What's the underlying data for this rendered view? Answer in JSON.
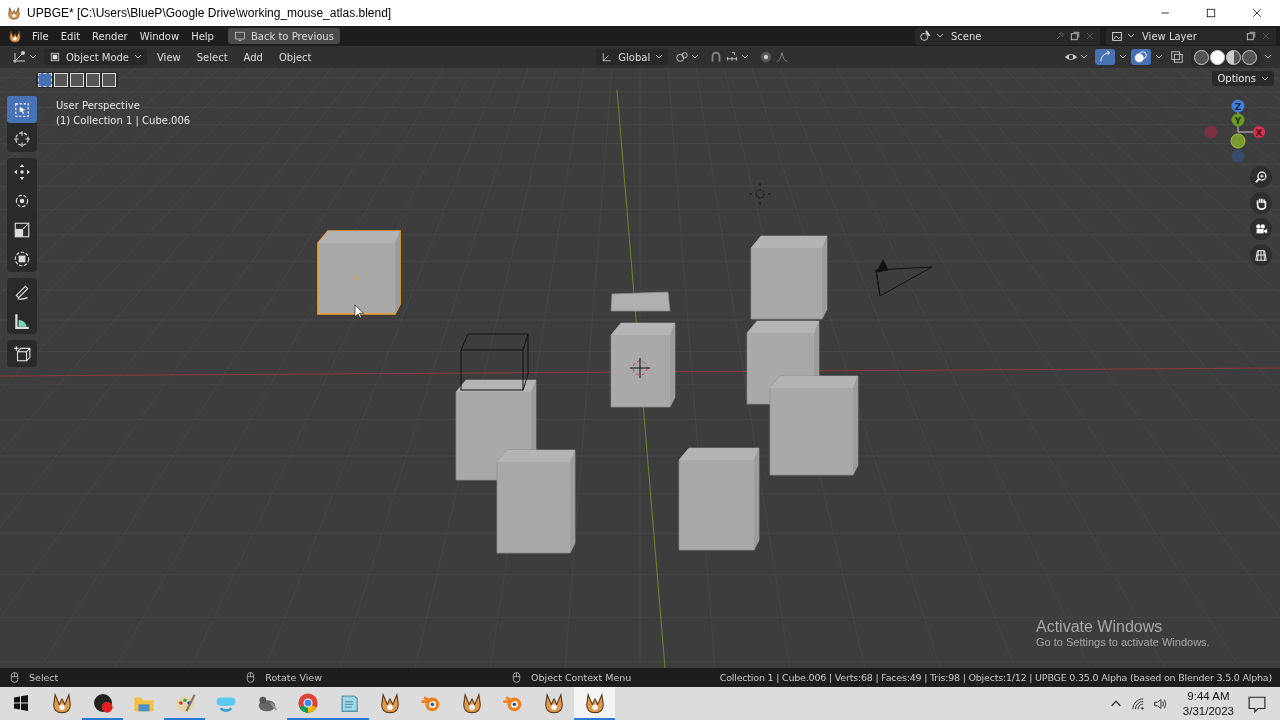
{
  "window": {
    "title": "UPBGE* [C:\\Users\\BlueP\\Google Drive\\working_mouse_atlas.blend]"
  },
  "menu": [
    "File",
    "Edit",
    "Render",
    "Window",
    "Help"
  ],
  "back_button": "Back to Previous",
  "scene": {
    "name": "Scene"
  },
  "view_layer": {
    "name": "View Layer"
  },
  "header": {
    "mode": "Object Mode",
    "menus": [
      "View",
      "Select",
      "Add",
      "Object"
    ],
    "orientation": "Global"
  },
  "select_modes": [
    {
      "selected": true
    },
    {
      "selected": false
    },
    {
      "selected": false
    },
    {
      "selected": false
    },
    {
      "selected": false
    }
  ],
  "shading_modes": [
    {
      "selected": false
    },
    {
      "selected": true
    },
    {
      "selected": false
    },
    {
      "selected": false
    }
  ],
  "options_button": "Options",
  "viewport": {
    "view_name": "User Perspective",
    "context": "(1) Collection 1 | Cube.006"
  },
  "tools": [
    {
      "kind": "select",
      "selected": true
    },
    {
      "kind": "cursor",
      "selected": false
    },
    {
      "kind": "move",
      "selected": false
    },
    {
      "kind": "rotate",
      "selected": false
    },
    {
      "kind": "scale",
      "selected": false
    },
    {
      "kind": "transform",
      "selected": false
    },
    {
      "kind": "annotate",
      "selected": false
    },
    {
      "kind": "measure",
      "selected": false
    },
    {
      "kind": "add-cube",
      "selected": false
    }
  ],
  "gizmo": {
    "z": "Z",
    "y": "Y",
    "x": "X"
  },
  "objects": [
    {
      "kind": "cube",
      "selected": true
    },
    {
      "kind": "cube",
      "selected": false
    },
    {
      "kind": "cube",
      "selected": false
    },
    {
      "kind": "cube",
      "selected": false
    },
    {
      "kind": "cube",
      "selected": false
    },
    {
      "kind": "cube",
      "selected": false
    },
    {
      "kind": "cube",
      "selected": false
    },
    {
      "kind": "cube",
      "selected": false
    },
    {
      "kind": "plane",
      "selected": false
    },
    {
      "kind": "wire-cube",
      "selected": false
    },
    {
      "kind": "light",
      "selected": false
    },
    {
      "kind": "camera",
      "selected": false
    }
  ],
  "activation": {
    "title": "Activate Windows",
    "subtitle": "Go to Settings to activate Windows."
  },
  "status_bar": {
    "hints": [
      "Select",
      "Rotate View",
      "Object Context Menu"
    ],
    "stats": "Collection 1 | Cube.006 | Verts:68 | Faces:49 | Tris:98 | Objects:1/12 | UPBGE 0.35.0 Alpha (based on Blender 3.5.0 Alpha)"
  },
  "taskbar": {
    "apps": [
      {
        "kind": "upbge",
        "running": false,
        "selected": false
      },
      {
        "kind": "recorder",
        "running": true,
        "selected": false
      },
      {
        "kind": "folder",
        "running": false,
        "selected": false
      },
      {
        "kind": "paint",
        "running": true,
        "selected": false
      },
      {
        "kind": "headset",
        "running": false,
        "selected": false
      },
      {
        "kind": "gimp",
        "running": false,
        "selected": false
      },
      {
        "kind": "browser",
        "running": true,
        "selected": false
      },
      {
        "kind": "notepad",
        "running": true,
        "selected": false
      },
      {
        "kind": "upbge",
        "running": false,
        "selected": false
      },
      {
        "kind": "blender",
        "running": false,
        "selected": false
      },
      {
        "kind": "upbge",
        "running": false,
        "selected": false
      },
      {
        "kind": "blender",
        "running": false,
        "selected": false
      },
      {
        "kind": "upbge",
        "running": false,
        "selected": false
      },
      {
        "kind": "upbge",
        "running": true,
        "selected": true
      }
    ],
    "time": "9:44 AM",
    "date": "3/31/2023"
  }
}
